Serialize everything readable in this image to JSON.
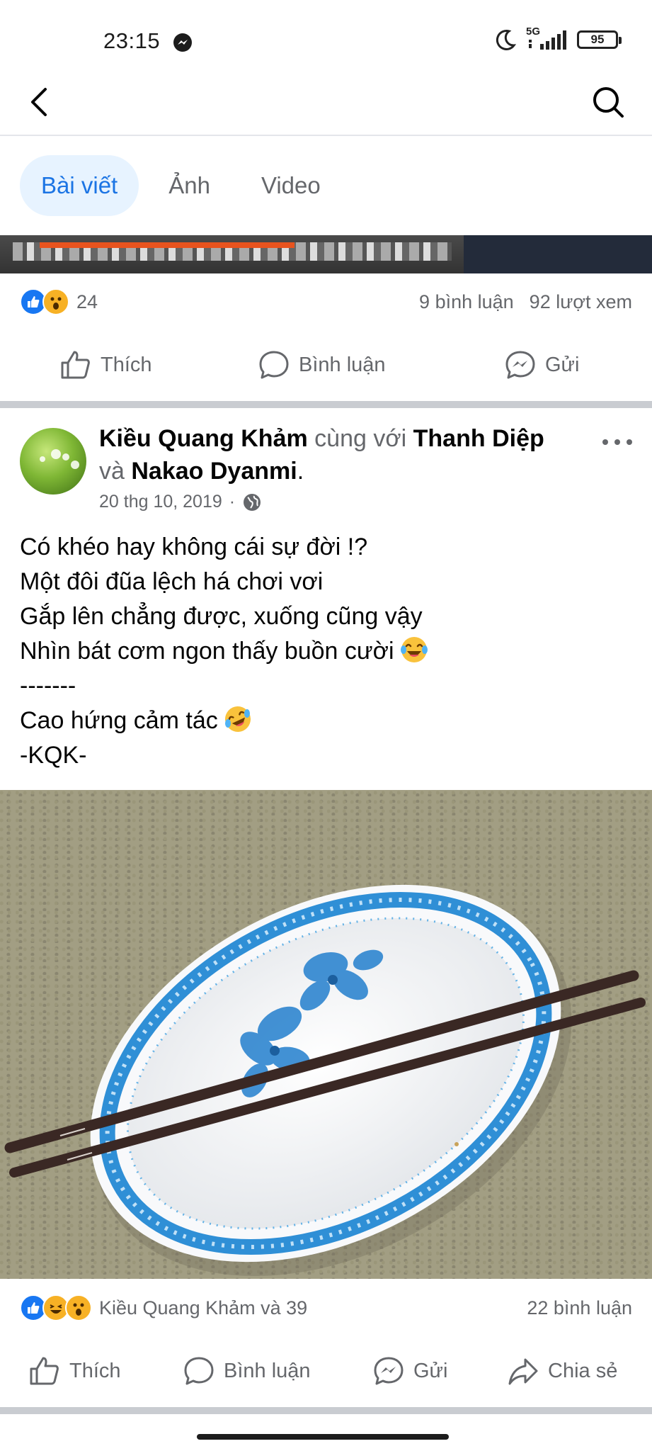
{
  "status": {
    "time": "23:15",
    "network": "5G",
    "battery": "95"
  },
  "tabs": [
    {
      "label": "Bài viết",
      "active": true
    },
    {
      "label": "Ảnh",
      "active": false
    },
    {
      "label": "Video",
      "active": false
    }
  ],
  "prev_post": {
    "reaction_count": "24",
    "comments": "9 bình luận",
    "views": "92 lượt xem",
    "actions": {
      "like": "Thích",
      "comment": "Bình luận",
      "send": "Gửi"
    }
  },
  "post": {
    "author": "Kiều Quang Khảm",
    "with_text": "cùng với",
    "tagged_1": "Thanh Diệp",
    "and_text": "và",
    "tagged_2": "Nakao Dyanmi",
    "period": ".",
    "date": "20 thg 10, 2019",
    "separator": "·",
    "lines": [
      "Có khéo hay không cái sự đời !?",
      "Một đôi đũa lệch há chơi vơi",
      "Gắp lên chẳng được, xuống cũng vậy",
      "Nhìn bát cơm ngon thấy buồn cười",
      "-------",
      "Cao hứng cảm tác",
      "-KQK-"
    ],
    "reactions_text": "Kiều Quang Khảm và 39",
    "comments": "22 bình luận",
    "actions": {
      "like": "Thích",
      "comment": "Bình luận",
      "send": "Gửi",
      "share": "Chia sẻ"
    }
  },
  "icons": [
    "back-arrow-icon",
    "search-icon",
    "messenger-icon",
    "moon-icon",
    "signal-icon",
    "battery-icon",
    "like-icon",
    "comment-icon",
    "share-icon",
    "globe-icon",
    "more-icon"
  ],
  "colors": {
    "accent": "#1b74e4",
    "tab_active_bg": "#e7f3ff",
    "muted": "#65676b",
    "like_blue": "#1877f2",
    "reaction_yellow": "#f7b125"
  }
}
